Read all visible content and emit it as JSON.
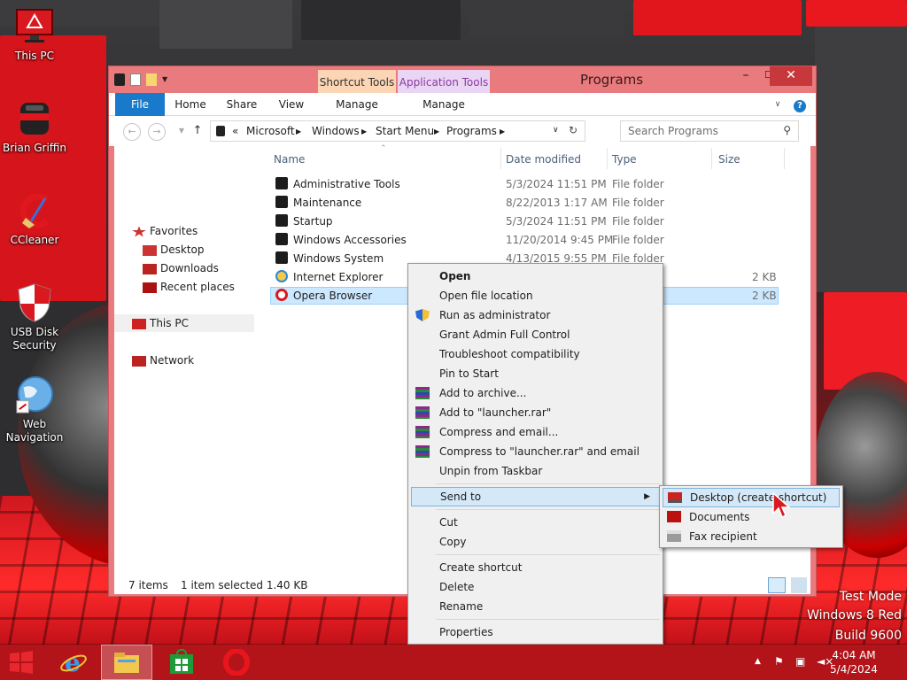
{
  "desktop": {
    "icons": [
      {
        "label": "This PC",
        "icon": "monitor-icon"
      },
      {
        "label": "Brian Griffin",
        "icon": "user-folder-icon"
      },
      {
        "label": "CCleaner",
        "icon": "ccleaner-icon"
      },
      {
        "label": "USB Disk Security",
        "icon": "shield-icon"
      },
      {
        "label": "Web Navigation",
        "icon": "globe-icon"
      }
    ],
    "watermark": {
      "line1": "Test Mode",
      "line2": "Windows 8 Red",
      "line3": "Build 9600"
    }
  },
  "window": {
    "title": "Programs",
    "context_tabs": {
      "shortcut_tools": "Shortcut Tools",
      "application_tools": "Application Tools"
    },
    "ribbon_tabs": {
      "file": "File",
      "home": "Home",
      "share": "Share",
      "view": "View",
      "manage1": "Manage",
      "manage2": "Manage"
    },
    "controls": {
      "minimize": "–",
      "maximize": "☐",
      "close": "✕"
    },
    "address": {
      "prefix": "«",
      "crumbs": [
        "Microsoft",
        "Windows",
        "Start Menu",
        "Programs"
      ]
    },
    "search": {
      "placeholder": "Search Programs"
    },
    "nav": {
      "favorites": "Favorites",
      "desktop": "Desktop",
      "downloads": "Downloads",
      "recent": "Recent places",
      "this_pc": "This PC",
      "network": "Network"
    },
    "columns": {
      "name": "Name",
      "date": "Date modified",
      "type": "Type",
      "size": "Size"
    },
    "files": [
      {
        "name": "Administrative Tools",
        "date": "5/3/2024 11:51 PM",
        "type": "File folder",
        "size": "",
        "icon": "folder-icon"
      },
      {
        "name": "Maintenance",
        "date": "8/22/2013 1:17 AM",
        "type": "File folder",
        "size": "",
        "icon": "folder-icon"
      },
      {
        "name": "Startup",
        "date": "5/3/2024 11:51 PM",
        "type": "File folder",
        "size": "",
        "icon": "folder-icon"
      },
      {
        "name": "Windows Accessories",
        "date": "11/20/2014 9:45 PM",
        "type": "File folder",
        "size": "",
        "icon": "folder-icon"
      },
      {
        "name": "Windows System",
        "date": "4/13/2015 9:55 PM",
        "type": "File folder",
        "size": "",
        "icon": "folder-icon"
      },
      {
        "name": "Internet Explorer",
        "date": "",
        "type": "",
        "size": "2 KB",
        "icon": "ie-icon"
      },
      {
        "name": "Opera Browser",
        "date": "",
        "type": "",
        "size": "2 KB",
        "icon": "opera-icon"
      }
    ],
    "status": {
      "count": "7 items",
      "selection": "1 item selected  1.40 KB"
    }
  },
  "context_menu": {
    "items": [
      {
        "label": "Open",
        "bold": true,
        "icon": ""
      },
      {
        "label": "Open file location",
        "icon": ""
      },
      {
        "label": "Run as administrator",
        "icon": "uac-shield-icon"
      },
      {
        "label": "Grant Admin Full Control",
        "icon": ""
      },
      {
        "label": "Troubleshoot compatibility",
        "icon": ""
      },
      {
        "label": "Pin to Start",
        "icon": ""
      },
      {
        "label": "Add to archive...",
        "icon": "winrar-icon"
      },
      {
        "label": "Add to \"launcher.rar\"",
        "icon": "winrar-icon"
      },
      {
        "label": "Compress and email...",
        "icon": "winrar-icon"
      },
      {
        "label": "Compress to \"launcher.rar\" and email",
        "icon": "winrar-icon"
      },
      {
        "label": "Unpin from Taskbar",
        "icon": ""
      },
      {
        "label": "Send to",
        "icon": "",
        "submenu": true
      },
      {
        "label": "Cut",
        "icon": ""
      },
      {
        "label": "Copy",
        "icon": ""
      },
      {
        "label": "Create shortcut",
        "icon": ""
      },
      {
        "label": "Delete",
        "icon": ""
      },
      {
        "label": "Rename",
        "icon": ""
      },
      {
        "label": "Properties",
        "icon": ""
      }
    ],
    "send_to": [
      {
        "label": "Desktop (create shortcut)",
        "icon": "desktop-icon"
      },
      {
        "label": "Documents",
        "icon": "documents-icon"
      },
      {
        "label": "Fax recipient",
        "icon": "fax-icon"
      }
    ]
  },
  "taskbar": {
    "items": [
      "start-icon",
      "internet-explorer-icon",
      "file-explorer-icon",
      "store-icon",
      "opera-icon"
    ],
    "clock": {
      "time": "4:04 AM",
      "date": "5/4/2024"
    }
  },
  "colors": {
    "accent": "#1979ca",
    "window_frame": "#e97a7e",
    "taskbar": "#b2141a",
    "highlight": "#cce8ff"
  }
}
